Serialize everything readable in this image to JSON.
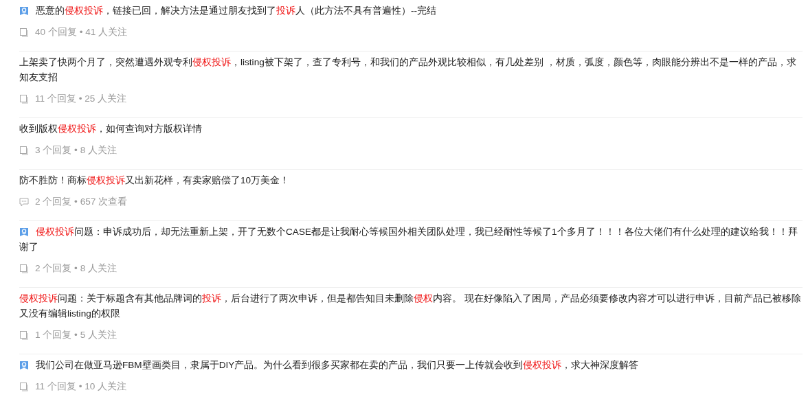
{
  "questions": [
    {
      "badge": true,
      "title": [
        {
          "text": "恶意的",
          "highlight": false
        },
        {
          "text": "侵权投诉",
          "highlight": true
        },
        {
          "text": "，链接已回，解决方法是通过朋友找到了",
          "highlight": false
        },
        {
          "text": "投诉",
          "highlight": true
        },
        {
          "text": "人（此方法不具有普遍性）--完结",
          "highlight": false
        }
      ],
      "kind": "doc",
      "meta": "40 个回复 • 41 人关注"
    },
    {
      "badge": false,
      "title": [
        {
          "text": "上架卖了快两个月了，突然遭遇外观专利",
          "highlight": false
        },
        {
          "text": "侵权投诉",
          "highlight": true
        },
        {
          "text": "，listing被下架了，查了专利号，和我们的产品外观比较相似，有几处差别 ，材质，弧度，颜色等，肉眼能分辨出不是一样的产品，求知友支招",
          "highlight": false
        }
      ],
      "kind": "doc",
      "meta": "11 个回复 • 25 人关注"
    },
    {
      "badge": false,
      "title": [
        {
          "text": "收到版权",
          "highlight": false
        },
        {
          "text": "侵权投诉",
          "highlight": true
        },
        {
          "text": "，如何查询对方版权详情",
          "highlight": false
        }
      ],
      "kind": "doc",
      "meta": "3 个回复 • 8 人关注"
    },
    {
      "badge": false,
      "title": [
        {
          "text": "防不胜防！商标",
          "highlight": false
        },
        {
          "text": "侵权投诉",
          "highlight": true
        },
        {
          "text": "又出新花样，有卖家赔偿了10万美金！",
          "highlight": false
        }
      ],
      "kind": "comment",
      "meta": "2 个回复 • 657 次查看"
    },
    {
      "badge": true,
      "title": [
        {
          "text": "侵权投诉",
          "highlight": true
        },
        {
          "text": "问题：申诉成功后，却无法重新上架，开了无数个CASE都是让我耐心等候国外相关团队处理，我已经耐性等候了1个多月了！！！各位大佬们有什么处理的建议给我！！拜谢了",
          "highlight": false
        }
      ],
      "kind": "doc",
      "meta": "2 个回复 • 8 人关注"
    },
    {
      "badge": false,
      "title": [
        {
          "text": "侵权投诉",
          "highlight": true
        },
        {
          "text": "问题：关于标题含有其他品牌词的",
          "highlight": false
        },
        {
          "text": "投诉",
          "highlight": true
        },
        {
          "text": "，后台进行了两次申诉，但是都告知目未删除",
          "highlight": false
        },
        {
          "text": "侵权",
          "highlight": true
        },
        {
          "text": "内容。 现在好像陷入了困局，产品必须要修改内容才可以进行申诉，目前产品已被移除又没有编辑listing的权限",
          "highlight": false
        }
      ],
      "kind": "doc",
      "meta": "1 个回复 • 5 人关注"
    },
    {
      "badge": true,
      "title": [
        {
          "text": "我们公司在做亚马逊FBM壁画类目，隶属于DIY产品。为什么看到很多买家都在卖的产品，我们只要一上传就会收到",
          "highlight": false
        },
        {
          "text": "侵权投诉",
          "highlight": true
        },
        {
          "text": "，求大神深度解答",
          "highlight": false
        }
      ],
      "kind": "doc",
      "meta": "11 个回复 • 10 人关注"
    }
  ]
}
